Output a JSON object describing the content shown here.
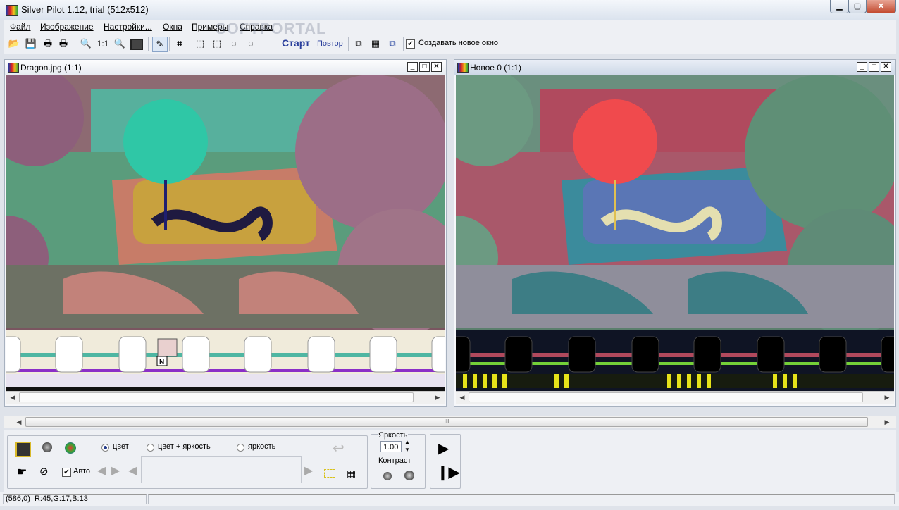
{
  "window": {
    "title": "Silver Pilot 1.12, trial (512x512)"
  },
  "menu": [
    "Файл",
    "Изображение",
    "Настройки...",
    "Окна",
    "Примеры",
    "Справка"
  ],
  "watermark": "SOFTPORTAL",
  "toolbar": {
    "zoom_label": "1:1",
    "start_label": "Старт",
    "repeat_label": "Повтор",
    "new_window_checkbox": "Создавать новое окно",
    "new_window_checked": true
  },
  "left_window": {
    "title": "Dragon.jpg (1:1)"
  },
  "right_window": {
    "title": "Новое 0 (1:1)"
  },
  "marker_letter": "N",
  "mdi_scroll_grip": "III",
  "panel": {
    "radio_color": "цвет",
    "radio_color_brightness": "цвет + яркость",
    "radio_brightness": "яркость",
    "selected_mode": "цвет",
    "auto_label": "Авто",
    "auto_checked": true,
    "brightness_label": "Яркость",
    "brightness_value": "1.00",
    "contrast_label": "Контраст"
  },
  "status": {
    "coords": "(586,0)",
    "rgb": "R:45,G:17,B:13"
  }
}
